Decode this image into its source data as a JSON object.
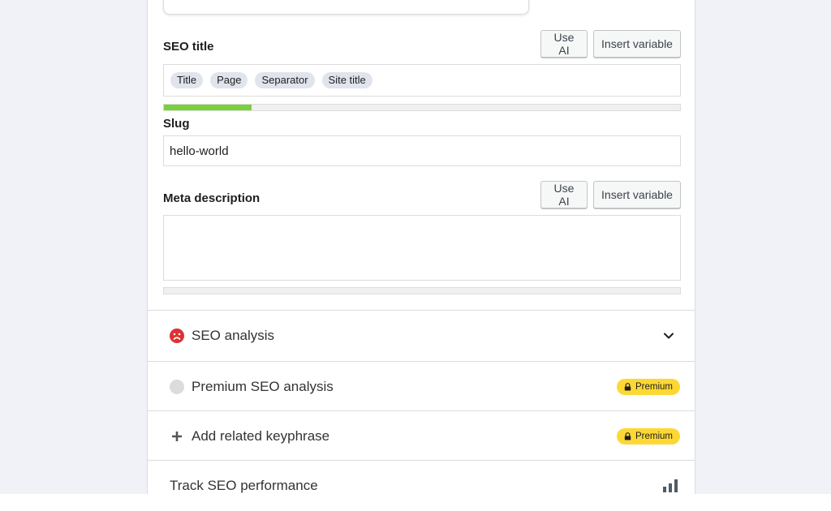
{
  "seo_title": {
    "label": "SEO title",
    "use_ai_label": "Use AI",
    "insert_variable_label": "Insert variable",
    "variables": [
      "Title",
      "Page",
      "Separator",
      "Site title"
    ],
    "progress_fraction": 0.17,
    "progress_color": "#7ad03a"
  },
  "slug": {
    "label": "Slug",
    "value": "hello-world"
  },
  "meta_description": {
    "label": "Meta description",
    "use_ai_label": "Use AI",
    "insert_variable_label": "Insert variable",
    "value": "",
    "progress_fraction": 0
  },
  "sections": {
    "seo_analysis": {
      "label": "SEO analysis",
      "icon": "sad-face-icon",
      "status_color": "#dc3232"
    },
    "premium_seo_analysis": {
      "label": "Premium SEO analysis",
      "badge": "Premium"
    },
    "related_keyphrase": {
      "label": "Add related keyphrase",
      "badge": "Premium"
    },
    "track_performance": {
      "label": "Track SEO performance",
      "icon": "bar-chart-icon"
    }
  },
  "colors": {
    "premium_badge": "#fdd834",
    "accent_green": "#7ad03a",
    "error_red": "#dc3232"
  }
}
